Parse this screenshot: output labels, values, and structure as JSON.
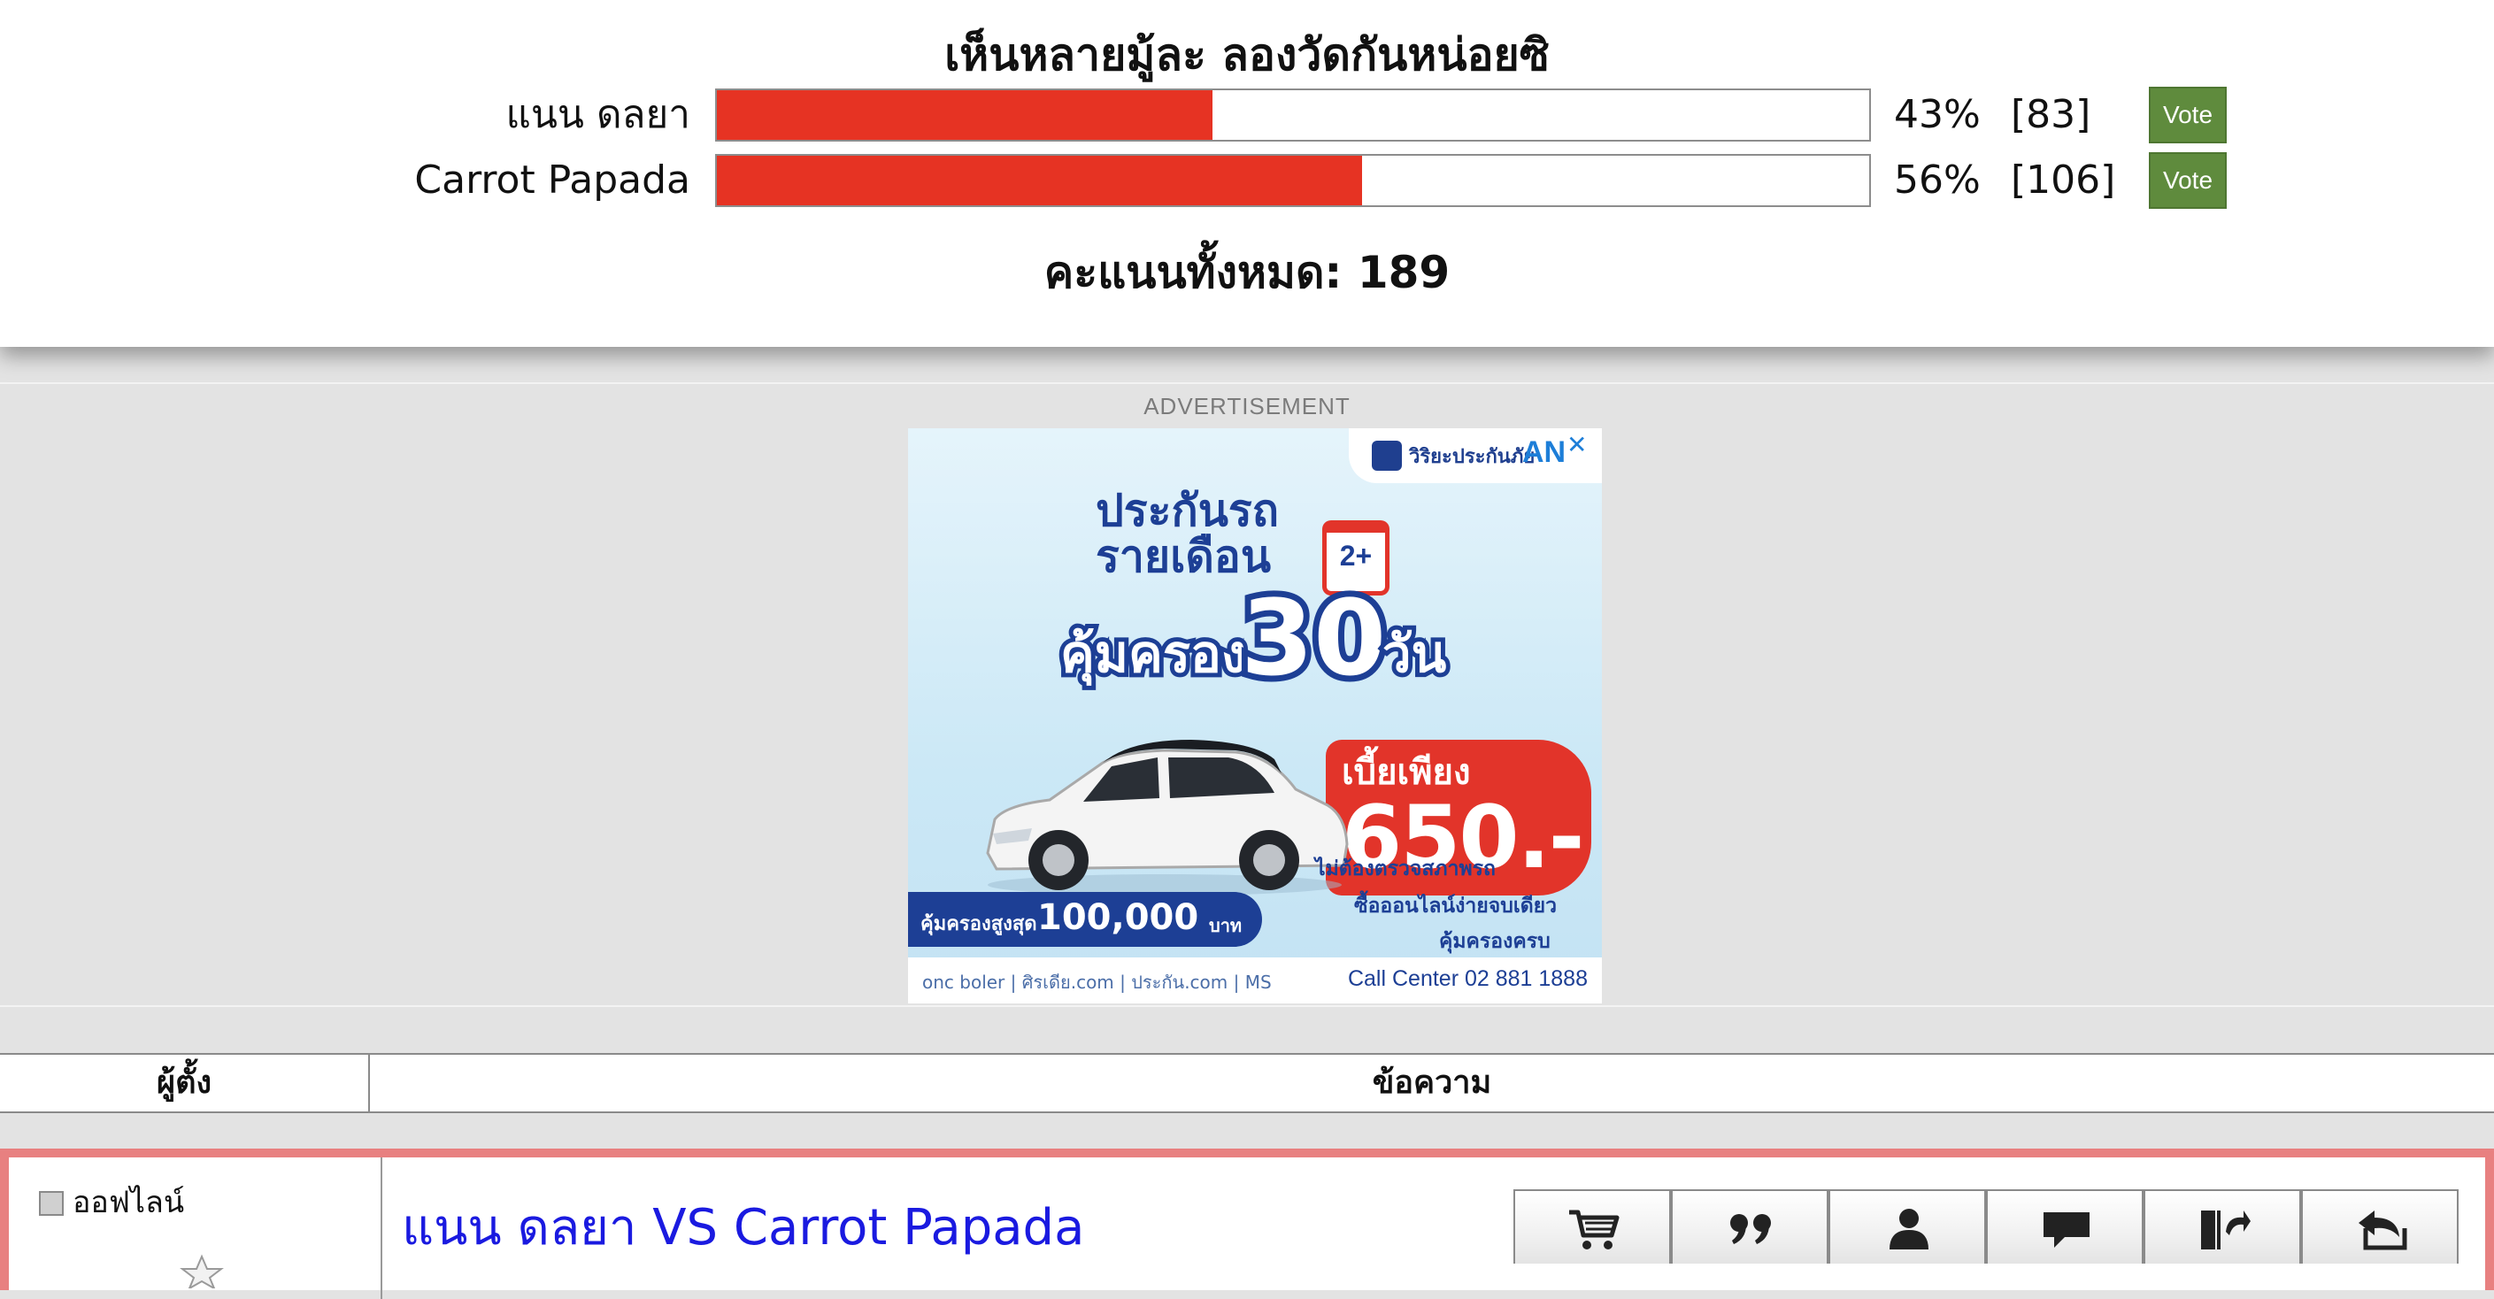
{
  "poll": {
    "title": "เห็นหลายมู้ละ ลองวัดกันหน่อยซิ",
    "options": [
      {
        "label": "แนน ดลยา",
        "percent": 43,
        "percent_text": "43%",
        "count_text": "[83]",
        "vote_label": "Vote"
      },
      {
        "label": "Carrot Papada",
        "percent": 56,
        "percent_text": "56%",
        "count_text": "[106]",
        "vote_label": "Vote"
      }
    ],
    "total_text": "คะแนนทั้งหมด: 189",
    "bar_color": "#e63323",
    "vote_button_color": "#5f8b3d"
  },
  "ad": {
    "label": "ADVERTISEMENT",
    "brand": "วิริยะประกันภัย",
    "brand_short": "AN",
    "headline_line1": "ประกันรถ",
    "headline_line2": "รายเดือน",
    "calendar_badge": "2+",
    "coverage_label": "คุ้มครอง",
    "coverage_days": "30",
    "coverage_unit": "วัน",
    "price_label": "เบี้ยเพียง",
    "price_value": "650.-",
    "max_coverage_label": "คุ้มครองสูงสุด",
    "max_coverage_value": "100,000",
    "max_coverage_unit": "บาท",
    "notes": [
      "ไม่ต้องตรวจสภาพรถ",
      "ซื้อออนไลน์ง่ายจบเดียว",
      "คุ้มครองครบ"
    ],
    "partners": "onc boler | ศิรเดีย.com | ประกัน.com | MS",
    "call_center": "Call Center 02 881 1888",
    "close_symbol": "✕"
  },
  "table": {
    "col_author": "ผู้ตั้ง",
    "col_message": "ข้อความ"
  },
  "post": {
    "status": "ออฟไลน์",
    "title": "แนน ดลยา VS Carrot Papada",
    "accent_color": "#e88080",
    "title_color": "#1a1ae0",
    "toolbar_icons": [
      "cart-icon",
      "quote-icon",
      "profile-icon",
      "message-icon",
      "exit-icon",
      "reply-icon"
    ]
  }
}
